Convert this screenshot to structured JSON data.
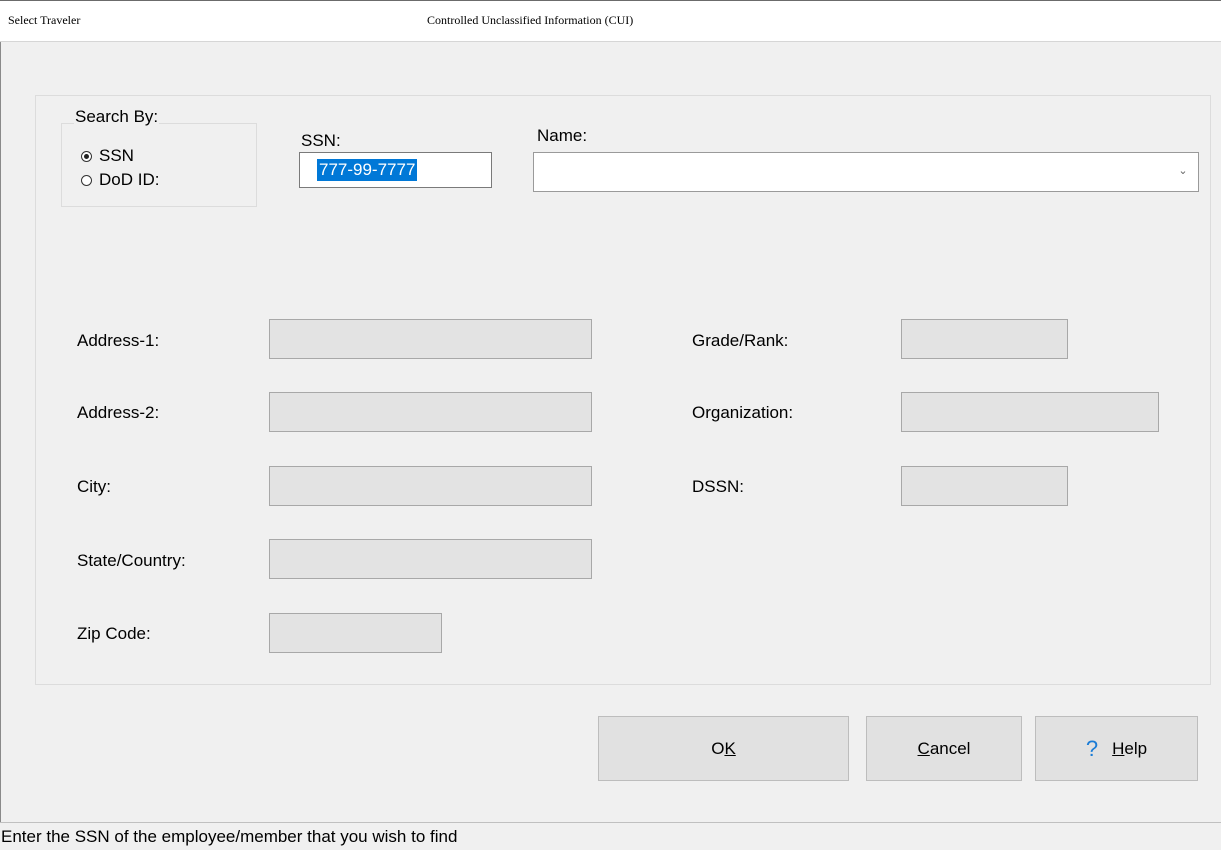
{
  "window": {
    "title_left": "Select Traveler",
    "title_center": "Controlled Unclassified Information (CUI)"
  },
  "search_by": {
    "legend": "Search By:",
    "options": [
      {
        "label": "SSN",
        "checked": true
      },
      {
        "label": "DoD ID:",
        "checked": false
      }
    ]
  },
  "ssn": {
    "label": "SSN:",
    "value": "777-99-7777"
  },
  "name": {
    "label": "Name:",
    "value": ""
  },
  "fields": {
    "address1": {
      "label": "Address-1:",
      "value": ""
    },
    "address2": {
      "label": "Address-2:",
      "value": ""
    },
    "city": {
      "label": "City:",
      "value": ""
    },
    "state_country": {
      "label": "State/Country:",
      "value": ""
    },
    "zip_code": {
      "label": "Zip Code:",
      "value": ""
    },
    "grade_rank": {
      "label": "Grade/Rank:",
      "value": ""
    },
    "organization": {
      "label": "Organization:",
      "value": ""
    },
    "dssn": {
      "label": "DSSN:",
      "value": ""
    }
  },
  "buttons": {
    "ok_pre": "O",
    "ok_mnemonic": "K",
    "cancel_mnemonic": "C",
    "cancel_rest": "ancel",
    "help_icon": "?",
    "help_mnemonic": "H",
    "help_rest": "elp"
  },
  "status": {
    "text": "Enter the SSN of the employee/member that you wish to find"
  },
  "colors": {
    "selection": "#0078d7",
    "help_icon": "#1b7cd6",
    "dialog_bg": "#f0f0f0",
    "readonly_field": "#e3e3e3"
  }
}
